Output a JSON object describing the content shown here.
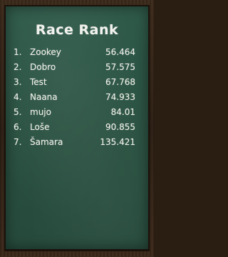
{
  "screen": {
    "title": "Race Rank"
  },
  "ranking": [
    {
      "rank": "1.",
      "name": "Zookey",
      "time": "56.464"
    },
    {
      "rank": "2.",
      "name": "Dobro",
      "time": "57.575"
    },
    {
      "rank": "3.",
      "name": "Test",
      "time": "67.768"
    },
    {
      "rank": "4.",
      "name": "Naana",
      "time": "74.933"
    },
    {
      "rank": "5.",
      "name": "mujo",
      "time": "84.01"
    },
    {
      "rank": "6.",
      "name": "Loše",
      "time": "90.855"
    },
    {
      "rank": "7.",
      "name": "Šamara",
      "time": "135.421"
    }
  ],
  "colors": {
    "board": "#2a5242",
    "frame": "#2f2116",
    "chalk": "#f0f0ea"
  }
}
